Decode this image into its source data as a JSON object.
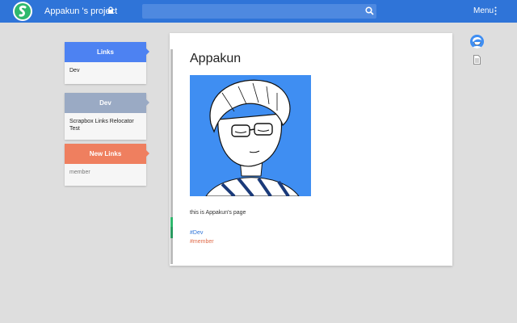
{
  "header": {
    "project_title": "Appakun 's project",
    "search": {
      "value": "",
      "placeholder": ""
    },
    "menu_label": "Menu",
    "icons": [
      "scrapbox-logo-icon",
      "lock-icon",
      "search-icon",
      "more-vertical-icon"
    ]
  },
  "sidebar": {
    "cards": [
      {
        "title": "Links",
        "items": [
          "Dev"
        ],
        "color": "#4d82f2"
      },
      {
        "title": "Dev",
        "items": [
          "Scrapbox Links Relocator Test"
        ],
        "color": "#9aaac4"
      },
      {
        "title": "New Links",
        "items": [
          "member"
        ],
        "color": "#ef7f5f"
      }
    ]
  },
  "page": {
    "title": "Appakun",
    "text": "this is Appakun's page",
    "tags": [
      "#Dev",
      "#member"
    ]
  },
  "right_icons": [
    "user-avatar-icon",
    "document-icon"
  ],
  "colors": {
    "topbar": "#2f74d8",
    "accent_green": "#2fb86d",
    "tag_link": "#2f74d8",
    "tag_new": "#e06a48"
  }
}
